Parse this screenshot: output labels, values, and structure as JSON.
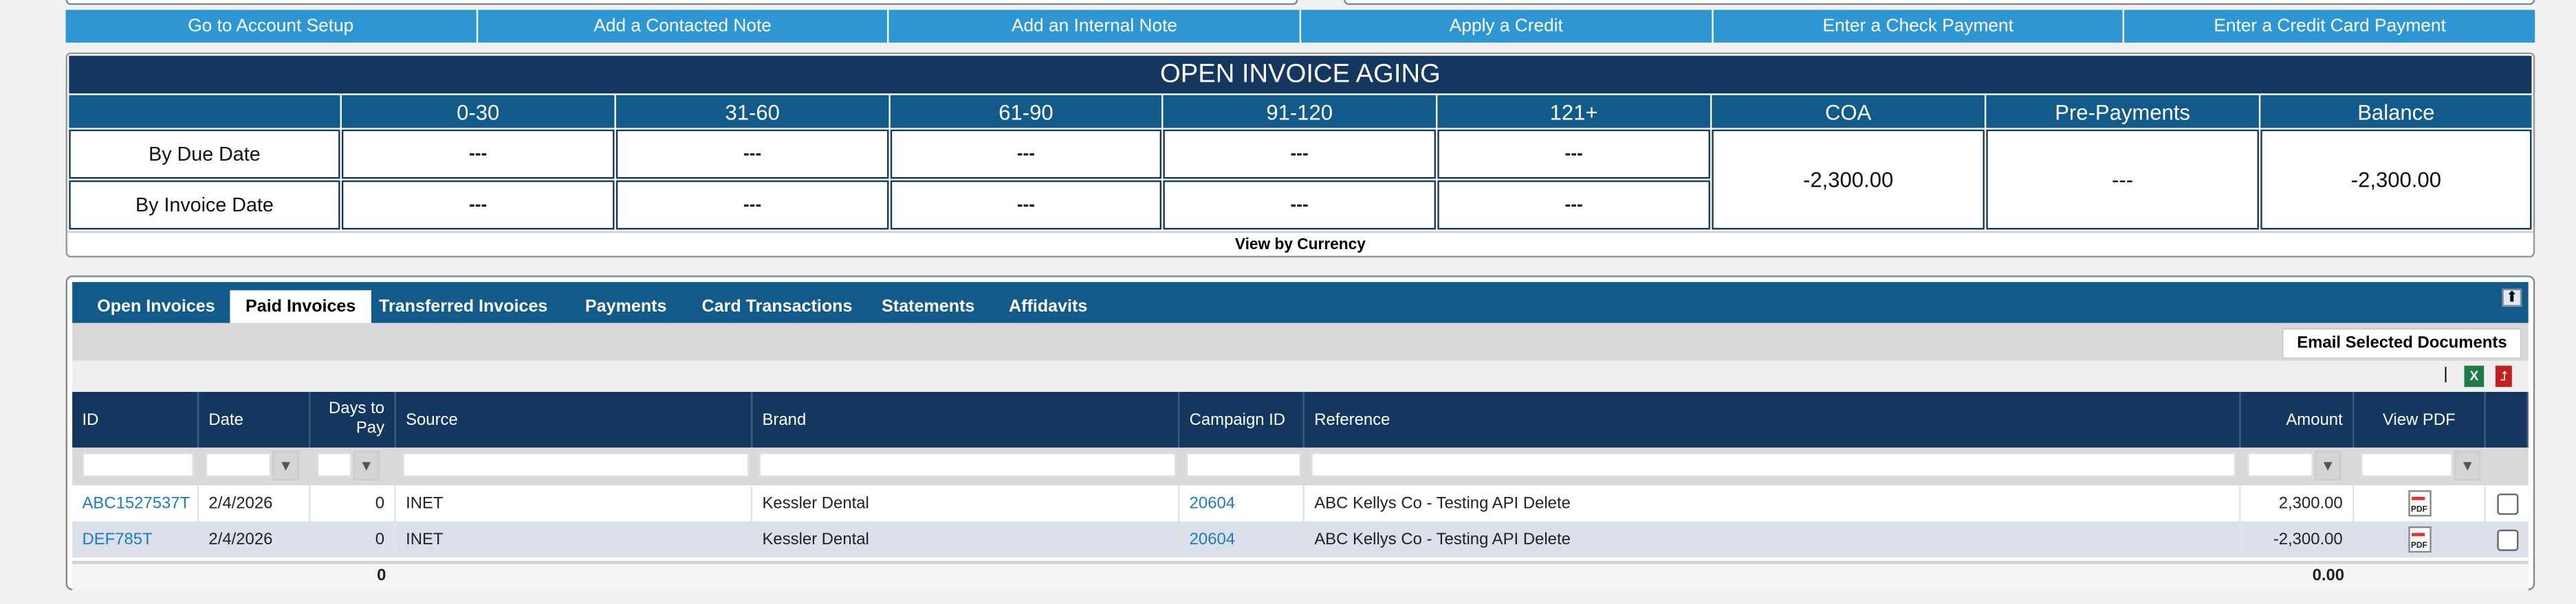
{
  "action_buttons": [
    "Go to Account Setup",
    "Add a Contacted Note",
    "Add an Internal Note",
    "Apply a Credit",
    "Enter a Check Payment",
    "Enter a Credit Card Payment"
  ],
  "aging": {
    "title": "OPEN INVOICE AGING",
    "columns": [
      "0-30",
      "31-60",
      "61-90",
      "91-120",
      "121+",
      "COA",
      "Pre-Payments",
      "Balance"
    ],
    "rows": [
      {
        "label": "By Due Date",
        "values": [
          "---",
          "---",
          "---",
          "---",
          "---"
        ]
      },
      {
        "label": "By Invoice Date",
        "values": [
          "---",
          "---",
          "---",
          "---",
          "---"
        ]
      }
    ],
    "coa": "-2,300.00",
    "prepayments": "---",
    "balance": "-2,300.00",
    "footer_link": "View by Currency"
  },
  "tabs": [
    "Open Invoices",
    "Paid Invoices",
    "Transferred Invoices",
    "Payments",
    "Card Transactions",
    "Statements",
    "Affidavits"
  ],
  "active_tab": "Paid Invoices",
  "email_button": "Email Selected Documents",
  "toolbar_separator": "|",
  "table": {
    "headers": [
      "ID",
      "Date",
      "Days to Pay",
      "Source",
      "Brand",
      "Campaign ID",
      "Reference",
      "Amount",
      "View PDF",
      ""
    ],
    "rows": [
      {
        "id": "ABC1527537T",
        "date": "2/4/2026",
        "days": "0",
        "source": "INET",
        "brand": "Kessler Dental",
        "campaign": "20604",
        "reference": "ABC Kellys Co - Testing API Delete",
        "amount": "2,300.00",
        "pdf": "PDF"
      },
      {
        "id": "DEF785T",
        "date": "2/4/2026",
        "days": "0",
        "source": "INET",
        "brand": "Kessler Dental",
        "campaign": "20604",
        "reference": "ABC Kellys Co - Testing API Delete",
        "amount": "-2,300.00",
        "pdf": "PDF"
      }
    ],
    "totals": {
      "days": "0",
      "amount": "0.00"
    }
  }
}
